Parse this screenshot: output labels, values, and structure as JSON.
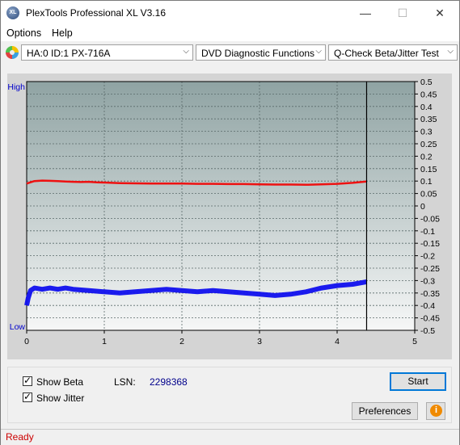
{
  "window": {
    "title": "PlexTools Professional XL V3.16",
    "app_icon_text": "XL"
  },
  "menu": {
    "items": [
      "Options",
      "Help"
    ]
  },
  "toolbar": {
    "drive": "HA:0 ID:1  PX-716A",
    "function": "DVD Diagnostic Functions",
    "test": "Q-Check Beta/Jitter Test"
  },
  "chart_data": {
    "type": "line",
    "left_axis_labels": {
      "top": "High",
      "bottom": "Low"
    },
    "x_ticks": [
      "0",
      "1",
      "2",
      "3",
      "4",
      "5"
    ],
    "xlim": [
      0,
      5
    ],
    "y_right_ticks": [
      "0.5",
      "0.45",
      "0.4",
      "0.35",
      "0.3",
      "0.25",
      "0.2",
      "0.15",
      "0.1",
      "0.05",
      "0",
      "-0.05",
      "-0.1",
      "-0.15",
      "-0.2",
      "-0.25",
      "-0.3",
      "-0.35",
      "-0.4",
      "-0.45",
      "-0.5"
    ],
    "ylim": [
      -0.5,
      0.5
    ],
    "end_marker_x": 4.38,
    "grid": true,
    "series": [
      {
        "color": "#ee1111",
        "x": [
          0,
          0.05,
          0.1,
          0.2,
          0.3,
          0.4,
          0.5,
          0.6,
          0.7,
          0.8,
          0.9,
          1.0,
          1.2,
          1.4,
          1.6,
          1.8,
          2.0,
          2.2,
          2.4,
          2.6,
          2.8,
          3.0,
          3.2,
          3.4,
          3.6,
          3.8,
          4.0,
          4.2,
          4.38
        ],
        "y": [
          0.09,
          0.095,
          0.1,
          0.102,
          0.101,
          0.1,
          0.098,
          0.097,
          0.096,
          0.097,
          0.095,
          0.094,
          0.092,
          0.091,
          0.09,
          0.09,
          0.09,
          0.089,
          0.089,
          0.088,
          0.088,
          0.087,
          0.086,
          0.086,
          0.085,
          0.087,
          0.089,
          0.093,
          0.098
        ]
      },
      {
        "color": "#1010ee",
        "x": [
          0,
          0.02,
          0.05,
          0.1,
          0.2,
          0.3,
          0.4,
          0.5,
          0.6,
          0.8,
          1.0,
          1.2,
          1.4,
          1.6,
          1.8,
          2.0,
          2.2,
          2.4,
          2.6,
          2.8,
          3.0,
          3.2,
          3.4,
          3.6,
          3.8,
          4.0,
          4.2,
          4.38
        ],
        "y": [
          -0.4,
          -0.37,
          -0.34,
          -0.33,
          -0.335,
          -0.33,
          -0.335,
          -0.33,
          -0.335,
          -0.34,
          -0.345,
          -0.35,
          -0.345,
          -0.34,
          -0.335,
          -0.34,
          -0.345,
          -0.34,
          -0.345,
          -0.35,
          -0.355,
          -0.36,
          -0.355,
          -0.345,
          -0.33,
          -0.32,
          -0.315,
          -0.305
        ]
      }
    ]
  },
  "controls": {
    "show_beta": "Show Beta",
    "show_jitter": "Show Jitter",
    "lsn_label": "LSN:",
    "lsn_value": "2298368",
    "start_button": "Start",
    "preferences_button": "Preferences",
    "info_icon": "i"
  },
  "colors": {
    "beta": "#ee1111",
    "jitter": "#1010ee",
    "low_high_label": "#0000cc",
    "status": "#cc0000"
  },
  "status": {
    "text": "Ready"
  }
}
